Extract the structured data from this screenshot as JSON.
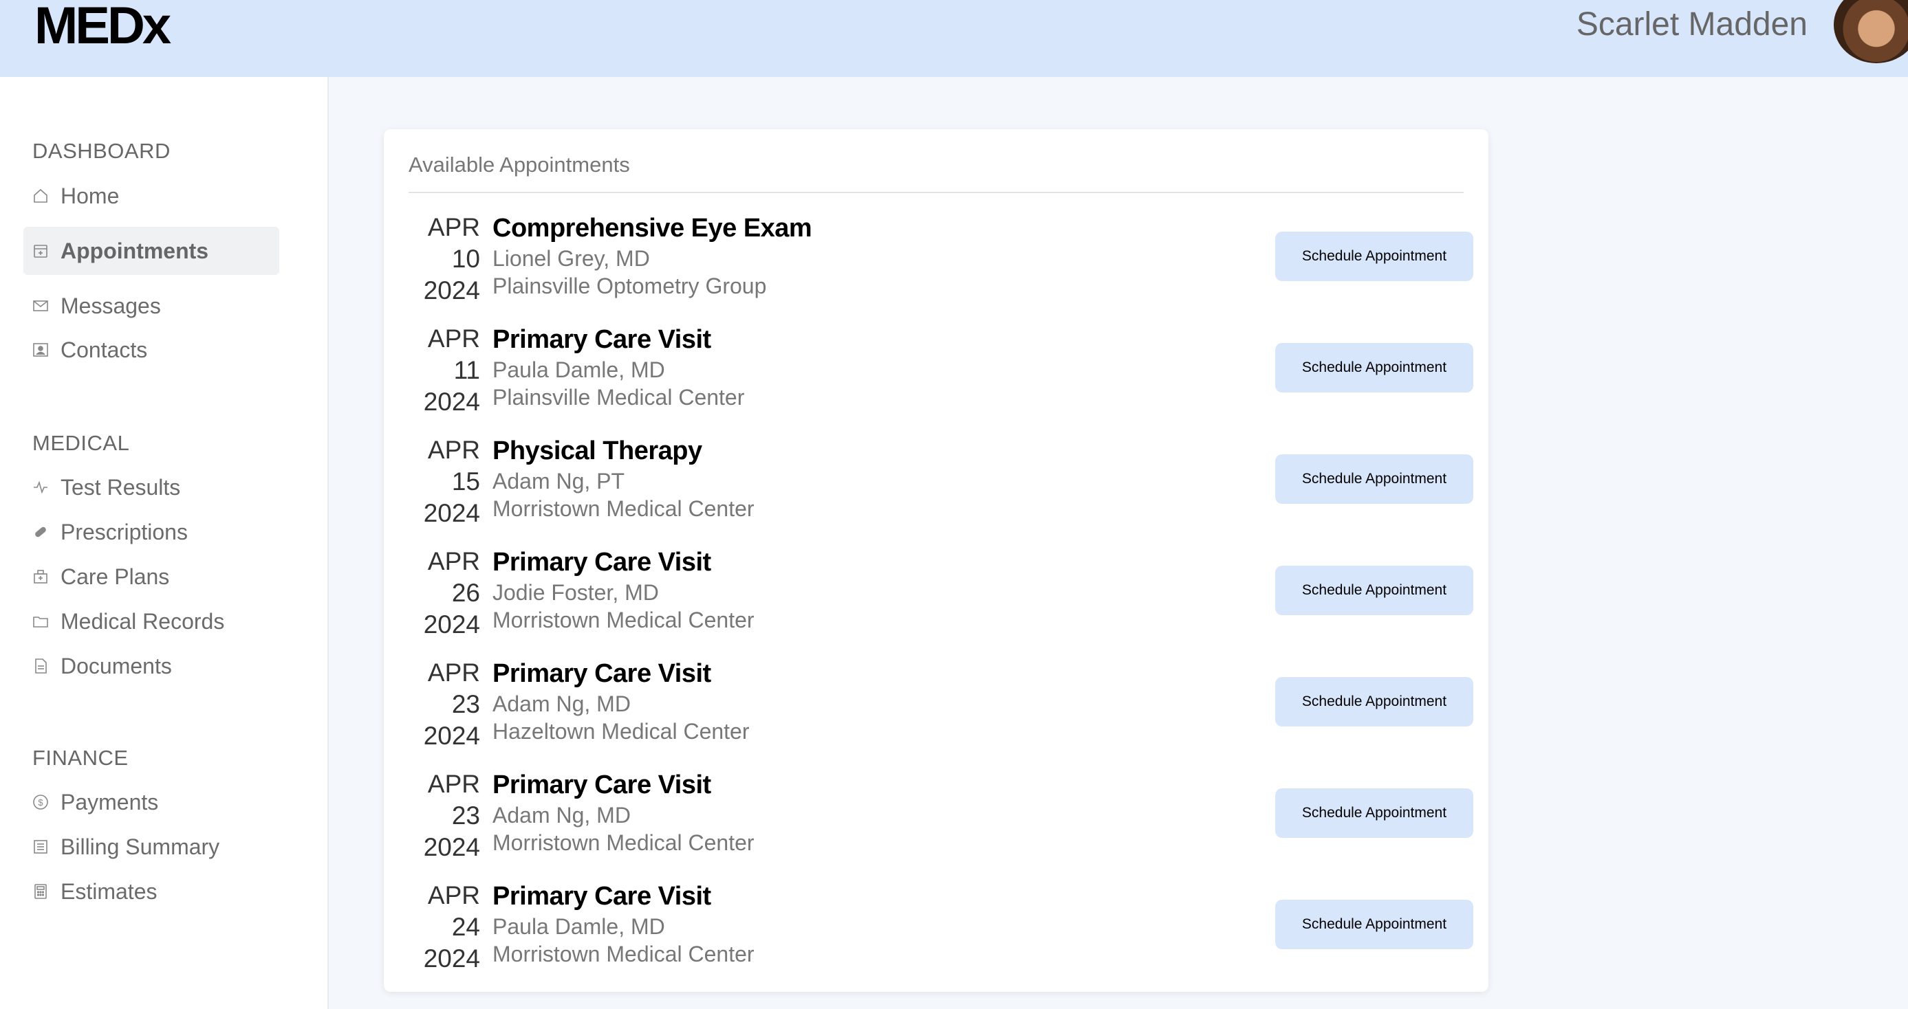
{
  "app": {
    "logo": "MEDx"
  },
  "user": {
    "name": "Scarlet Madden"
  },
  "sidebar": {
    "sections": [
      {
        "title": "DASHBOARD",
        "items": [
          {
            "label": "Home",
            "icon": "home-icon"
          },
          {
            "label": "Appointments",
            "icon": "calendar-icon",
            "active": true
          },
          {
            "label": "Messages",
            "icon": "envelope-icon"
          },
          {
            "label": "Contacts",
            "icon": "contact-card-icon"
          }
        ]
      },
      {
        "title": "MEDICAL",
        "items": [
          {
            "label": "Test Results",
            "icon": "pulse-icon"
          },
          {
            "label": "Prescriptions",
            "icon": "pill-icon"
          },
          {
            "label": "Care Plans",
            "icon": "hospital-icon"
          },
          {
            "label": "Medical Records",
            "icon": "folder-icon"
          },
          {
            "label": "Documents",
            "icon": "document-icon"
          }
        ]
      },
      {
        "title": "FINANCE",
        "items": [
          {
            "label": "Payments",
            "icon": "dollar-circle-icon"
          },
          {
            "label": "Billing Summary",
            "icon": "list-icon"
          },
          {
            "label": "Estimates",
            "icon": "calculator-icon"
          }
        ]
      }
    ]
  },
  "appointments": {
    "title": "Available Appointments",
    "button_label": "Schedule Appointment",
    "items": [
      {
        "month": "APR",
        "day": "10",
        "year": "2024",
        "title": "Comprehensive Eye Exam",
        "provider": "Lionel Grey, MD",
        "location": "Plainsville Optometry Group"
      },
      {
        "month": "APR",
        "day": "11",
        "year": "2024",
        "title": "Primary Care Visit",
        "provider": "Paula Damle, MD",
        "location": "Plainsville Medical Center"
      },
      {
        "month": "APR",
        "day": "15",
        "year": "2024",
        "title": "Physical Therapy",
        "provider": "Adam Ng, PT",
        "location": "Morristown Medical Center"
      },
      {
        "month": "APR",
        "day": "26",
        "year": "2024",
        "title": "Primary Care Visit",
        "provider": "Jodie Foster, MD",
        "location": "Morristown Medical Center"
      },
      {
        "month": "APR",
        "day": "23",
        "year": "2024",
        "title": "Primary Care Visit",
        "provider": "Adam Ng, MD",
        "location": "Hazeltown Medical Center"
      },
      {
        "month": "APR",
        "day": "23",
        "year": "2024",
        "title": "Primary Care Visit",
        "provider": "Adam Ng, MD",
        "location": "Morristown Medical Center"
      },
      {
        "month": "APR",
        "day": "24",
        "year": "2024",
        "title": "Primary Care Visit",
        "provider": "Paula Damle, MD",
        "location": "Morristown Medical Center"
      }
    ]
  },
  "colors": {
    "header_bg": "#d8e6fc",
    "button_bg": "#d8e6fc",
    "page_bg": "#f4f7fc"
  }
}
